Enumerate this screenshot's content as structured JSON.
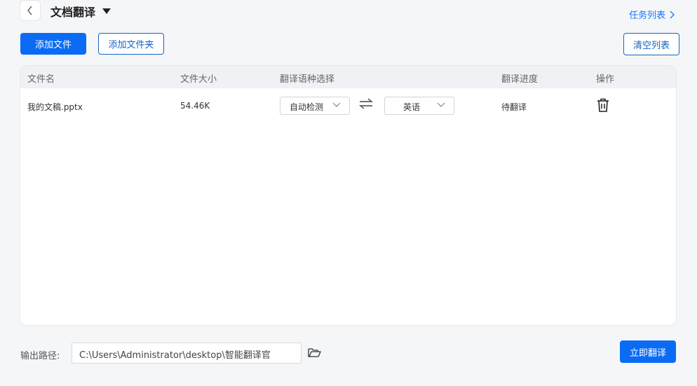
{
  "header": {
    "title": "文档翻译",
    "task_list_label": "任务列表"
  },
  "toolbar": {
    "add_file_label": "添加文件",
    "add_folder_label": "添加文件夹",
    "clear_list_label": "清空列表"
  },
  "table": {
    "columns": [
      "文件名",
      "文件大小",
      "翻译语种选择",
      "翻译进度",
      "操作"
    ],
    "rows": [
      {
        "filename": "我的文稿.pptx",
        "size": "54.46K",
        "source_lang": "自动检测",
        "target_lang": "英语",
        "progress": "待翻译"
      }
    ]
  },
  "footer": {
    "output_label": "输出路径:",
    "output_path": "C:\\Users\\Administrator\\desktop\\智能翻译官",
    "translate_label": "立即翻译"
  },
  "colors": {
    "accent": "#0a6cf5",
    "background": "#f5f6f8"
  }
}
